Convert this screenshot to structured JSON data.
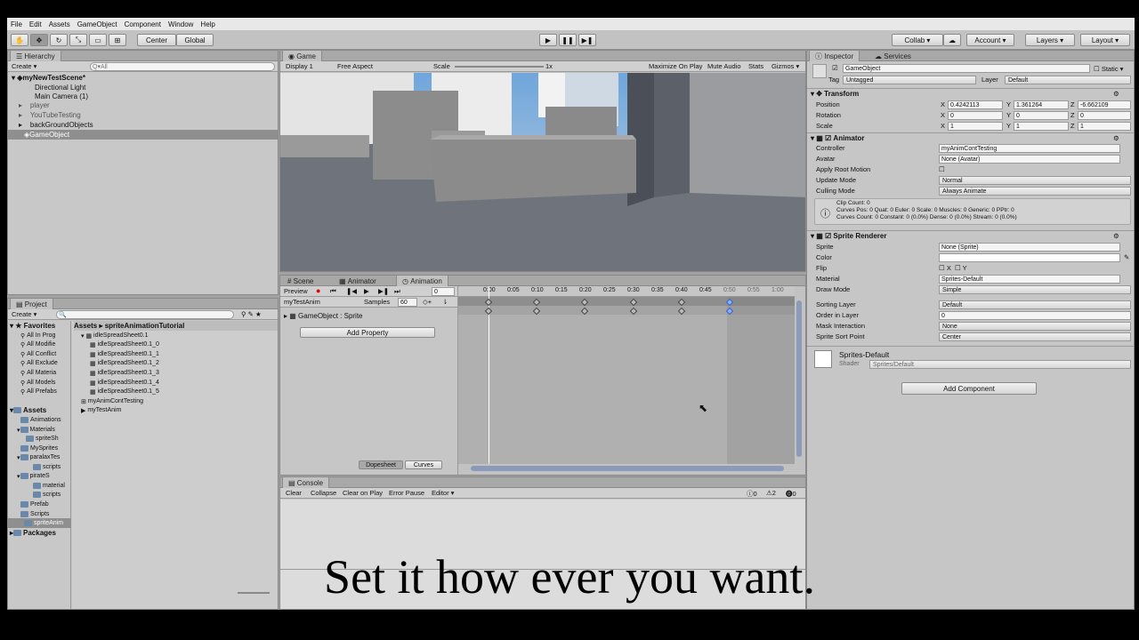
{
  "menu": [
    "File",
    "Edit",
    "Assets",
    "GameObject",
    "Component",
    "Window",
    "Help"
  ],
  "toolbar": {
    "center": "Center",
    "global": "Global",
    "collab": "Collab ▾",
    "account": "Account ▾",
    "layers": "Layers ▾",
    "layout": "Layout ▾"
  },
  "hierarchy": {
    "tab": "Hierarchy",
    "create": "Create ▾",
    "search_placeholder": "Q▾All",
    "scene": "myNewTestScene*",
    "items": [
      "Directional Light",
      "Main Camera (1)",
      "player",
      "YouTubeTesting",
      "backGroundObjects",
      "GameObject"
    ]
  },
  "game": {
    "tab": "Game",
    "display": "Display 1",
    "aspect": "Free Aspect",
    "scale_label": "Scale",
    "scale_value": "1x",
    "maximize": "Maximize On Play",
    "mute": "Mute Audio",
    "stats": "Stats",
    "gizmos": "Gizmos ▾"
  },
  "animation": {
    "tabs": [
      "Scene",
      "Animator",
      "Animation"
    ],
    "preview": "Preview",
    "frame": "0",
    "clip": "myTestAnim",
    "samples_label": "Samples",
    "samples_value": "60",
    "property": "GameObject : Sprite",
    "add_property": "Add Property",
    "dopesheet": "Dopesheet",
    "curves": "Curves",
    "ticks": [
      "0:00",
      "0:05",
      "0:10",
      "0:15",
      "0:20",
      "0:25",
      "0:30",
      "0:35",
      "0:40",
      "0:45",
      "0:50",
      "0:55",
      "1:00"
    ]
  },
  "console": {
    "tab": "Console",
    "buttons": [
      "Clear",
      "Collapse",
      "Clear on Play",
      "Error Pause",
      "Editor ▾"
    ],
    "counts": [
      "0",
      "2",
      "0"
    ]
  },
  "project": {
    "tab": "Project",
    "create": "Create ▾",
    "favorites_label": "Favorites",
    "favorites": [
      "All In Prog",
      "All Modifie",
      "All Conflict",
      "All Exclude",
      "All Materia",
      "All Models",
      "All Prefabs"
    ],
    "assets_label": "Assets",
    "assets_tree": [
      "Animations",
      "Materials",
      "spriteSh",
      "MySprites",
      "paralaxTes",
      "scripts",
      "pirateS",
      "material",
      "scripts",
      "Prefab",
      "Scripts",
      "spriteAnim"
    ],
    "packages": "Packages",
    "breadcrumb": [
      "Assets",
      "spriteAnimationTutorial"
    ],
    "files": [
      "idleSpreadSheet0.1",
      "idleSpreadSheet0.1_0",
      "idleSpreadSheet0.1_1",
      "idleSpreadSheet0.1_2",
      "idleSpreadSheet0.1_3",
      "idleSpreadSheet0.1_4",
      "idleSpreadSheet0.1_5",
      "myAnimContTesting",
      "myTestAnim"
    ]
  },
  "inspector": {
    "tab": "Inspector",
    "services": "Services",
    "name": "GameObject",
    "static": "Static",
    "tag_label": "Tag",
    "tag": "Untagged",
    "layer_label": "Layer",
    "layer": "Default",
    "transform": {
      "title": "Transform",
      "position": "Position",
      "rotation": "Rotation",
      "scale": "Scale",
      "px": "0.4242113",
      "py": "1.361264",
      "pz": "-6.662109",
      "rx": "0",
      "ry": "0",
      "rz": "0",
      "sx": "1",
      "sy": "1",
      "sz": "1"
    },
    "animator": {
      "title": "Animator",
      "controller_label": "Controller",
      "controller": "myAnimContTesting",
      "avatar_label": "Avatar",
      "avatar": "None (Avatar)",
      "apply_root": "Apply Root Motion",
      "update_label": "Update Mode",
      "update": "Normal",
      "culling_label": "Culling Mode",
      "culling": "Always Animate",
      "info1": "Clip Count: 0",
      "info2": "Curves Pos: 0 Quat: 0 Euler: 0 Scale: 0 Muscles: 0 Generic: 0 PPtr: 0",
      "info3": "Curves Count: 0 Constant: 0 (0.0%) Dense: 0 (0.0%) Stream: 0 (0.0%)"
    },
    "sprite_renderer": {
      "title": "Sprite Renderer",
      "sprite_label": "Sprite",
      "sprite": "None (Sprite)",
      "color_label": "Color",
      "flip_label": "Flip",
      "flip_x": "X",
      "flip_y": "Y",
      "material_label": "Material",
      "material": "Sprites-Default",
      "draw_label": "Draw Mode",
      "draw": "Simple",
      "sorting_label": "Sorting Layer",
      "sorting": "Default",
      "order_label": "Order in Layer",
      "order": "0",
      "mask_label": "Mask Interaction",
      "mask": "None",
      "sort_point_label": "Sprite Sort Point",
      "sort_point": "Center"
    },
    "material_name": "Sprites-Default",
    "shader_label": "Shader",
    "shader": "Sprites/Default",
    "add_component": "Add Component"
  },
  "caption": "Set it how ever you want."
}
